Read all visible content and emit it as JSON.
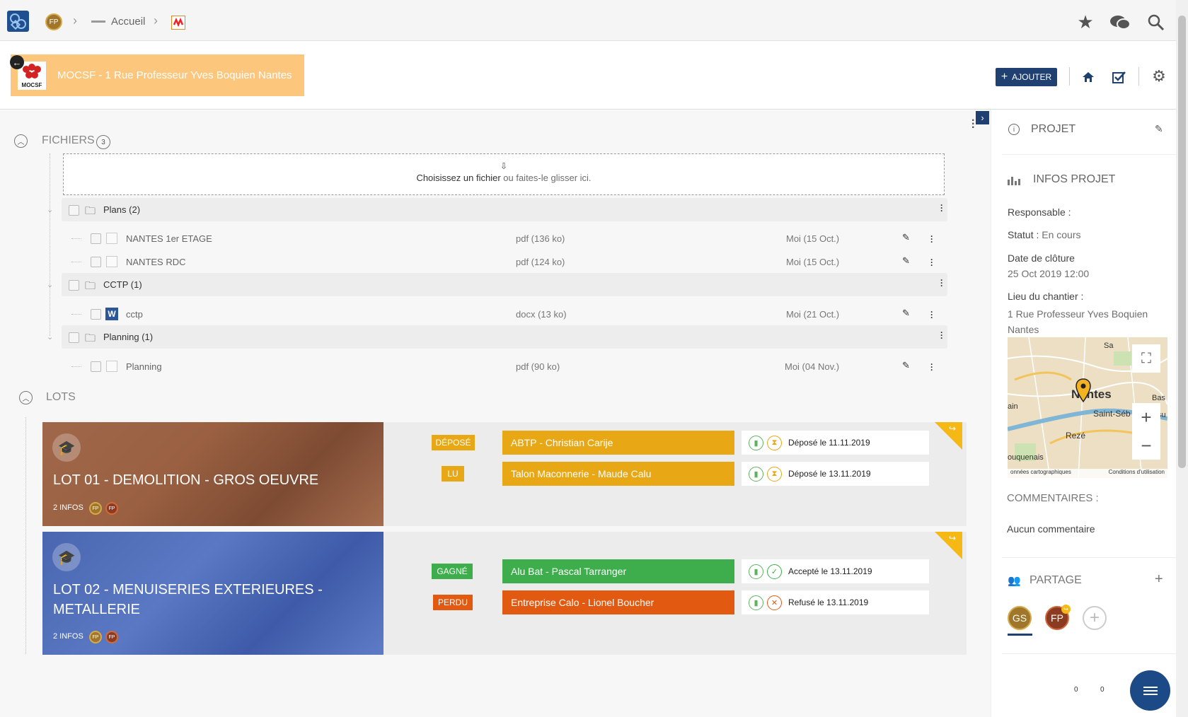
{
  "topbar": {
    "user_initials": "FP",
    "breadcrumb_home": "Accueil"
  },
  "project": {
    "title": "MOCSF - 1 Rue Professeur Yves Boquien Nantes",
    "logo_text": "MOCSF",
    "add_button": "AJOUTER"
  },
  "files": {
    "header": "FICHIERS",
    "count": "3",
    "dropzone_choose": "Choisissez un fichier",
    "dropzone_drag": " ou faites-le glisser ici.",
    "folders": [
      {
        "name": "Plans (2)",
        "files": [
          {
            "name": "NANTES 1er ETAGE",
            "type": "pdf (136 ko)",
            "date": "Moi (15 Oct.)"
          },
          {
            "name": "NANTES RDC",
            "type": "pdf (124 ko)",
            "date": "Moi (15 Oct.)"
          }
        ]
      },
      {
        "name": "CCTP (1)",
        "files": [
          {
            "name": "cctp",
            "type": "docx (13 ko)",
            "date": "Moi (21 Oct.)"
          }
        ]
      },
      {
        "name": "Planning (1)",
        "files": [
          {
            "name": "Planning",
            "type": "pdf (90 ko)",
            "date": "Moi (04 Nov.)"
          }
        ]
      }
    ]
  },
  "lots": {
    "header": "LOTS",
    "items": [
      {
        "name": "LOT 01 - DEMOLITION - GROS OEUVRE",
        "infos": "2 INFOS",
        "bids": [
          {
            "badge": "DÉPOSÉ",
            "badge_color": "#e8a714",
            "company": "ABTP - Christian Carije",
            "bar_color": "#e8a714",
            "status": "Déposé le 11.11.2019",
            "status_icon": "hourglass-icon"
          },
          {
            "badge": "LU",
            "badge_color": "#e8a714",
            "company": "Talon Maconnerie - Maude Calu",
            "bar_color": "#e8a714",
            "status": "Déposé le 13.11.2019",
            "status_icon": "hourglass-icon"
          }
        ]
      },
      {
        "name": "LOT 02 - MENUISERIES EXTERIEURES - METALLERIE",
        "infos": "2 INFOS",
        "bids": [
          {
            "badge": "GAGNÉ",
            "badge_color": "#3dae4b",
            "company": "Alu Bat - Pascal Tarranger",
            "bar_color": "#3dae4b",
            "status": "Accepté le 13.11.2019",
            "status_icon": "check-icon"
          },
          {
            "badge": "PERDU",
            "badge_color": "#e25a12",
            "company": "Entreprise Calo - Lionel Boucher",
            "bar_color": "#e25a12",
            "status": "Refusé le 13.11.2019",
            "status_icon": "cross-icon"
          }
        ]
      }
    ]
  },
  "sidebar": {
    "projet": "PROJET",
    "infos_projet": "INFOS PROJET",
    "responsable_label": "Responsable :",
    "statut_label": "Statut :",
    "statut_value": "En cours",
    "cloture_label": "Date de clôture",
    "cloture_value": "25 Oct 2019 12:00",
    "lieu_label": "Lieu du chantier :",
    "lieu_value": "1 Rue Professeur Yves Boquien Nantes",
    "map": {
      "city": "Nantes",
      "label_saint": "Saint-Séb",
      "label_reze": "Rezé",
      "label_sa": "Sa",
      "label_bas": "Bas",
      "label_ain": "ain",
      "label_ouq": "ouquenais",
      "label_su": "su",
      "footer_left": "onnées cartographiques",
      "footer_right": "Conditions d'utilisation"
    },
    "commentaires": "COMMENTAIRES :",
    "aucun": "Aucun commentaire",
    "partage": "PARTAGE",
    "share_users": [
      "GS",
      "FP"
    ]
  },
  "footer": {
    "count1": "0",
    "count2": "0"
  }
}
